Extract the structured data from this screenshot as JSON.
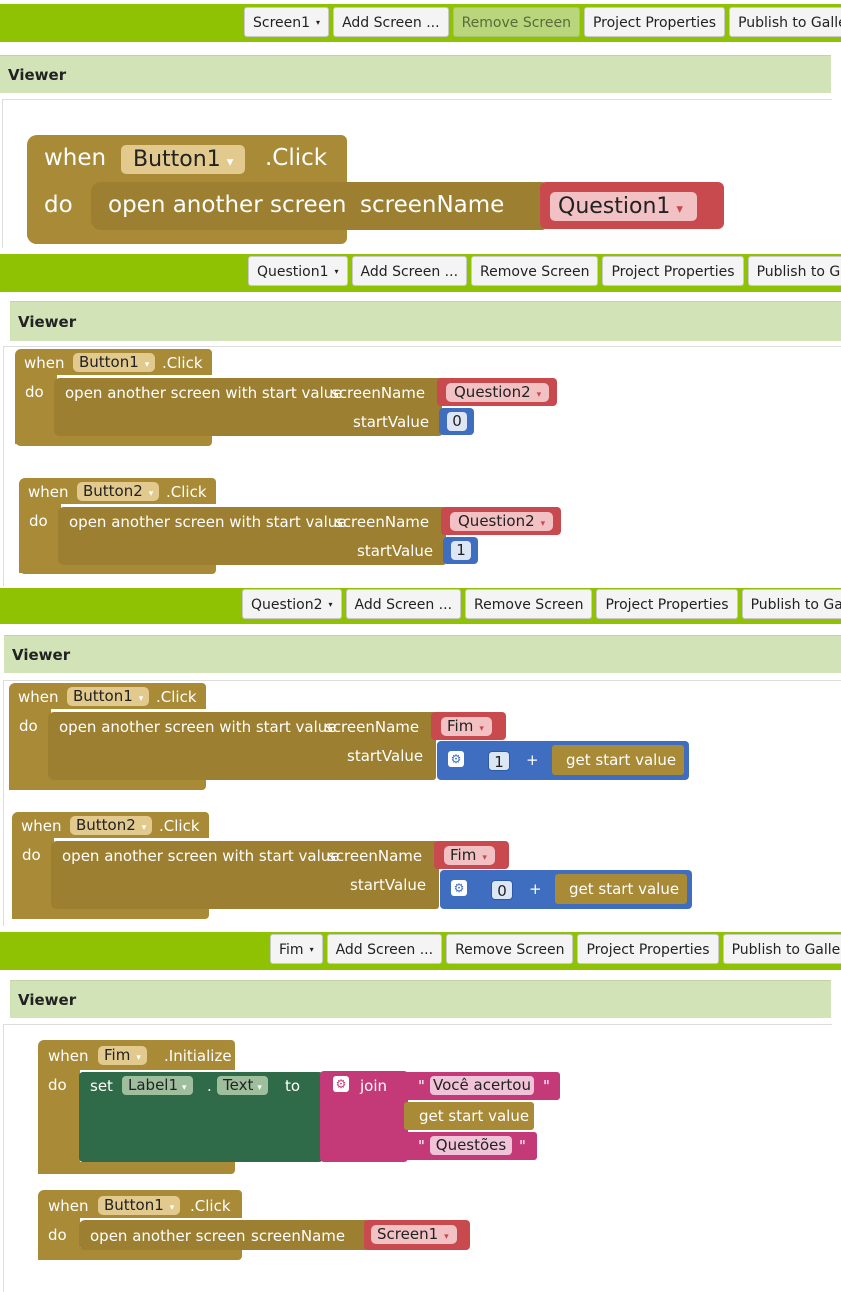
{
  "toolbar": {
    "add_screen": "Add Screen ...",
    "remove_screen": "Remove Screen",
    "project_properties": "Project Properties",
    "publish": "Publish to Gallery"
  },
  "viewer_label": "Viewer",
  "panels": [
    {
      "screen": "Screen1",
      "remove_disabled": true,
      "blocks": [
        {
          "when": "when",
          "component": "Button1",
          "event": ".Click",
          "do": "do",
          "action": "open another screen",
          "param": "screenName",
          "value": "Question1"
        }
      ]
    },
    {
      "screen": "Question1",
      "blocks": [
        {
          "when": "when",
          "component": "Button1",
          "event": ".Click",
          "do": "do",
          "action": "open another screen with start value",
          "param": "screenName",
          "value": "Question2",
          "param2": "startValue",
          "start": "0"
        },
        {
          "when": "when",
          "component": "Button2",
          "event": ".Click",
          "do": "do",
          "action": "open another screen with start value",
          "param": "screenName",
          "value": "Question2",
          "param2": "startValue",
          "start": "1"
        }
      ]
    },
    {
      "screen": "Question2",
      "blocks": [
        {
          "when": "when",
          "component": "Button1",
          "event": ".Click",
          "do": "do",
          "action": "open another screen with start value",
          "param": "screenName",
          "value": "Fim",
          "param2": "startValue",
          "start": "1",
          "op": "+",
          "getter": "get start value"
        },
        {
          "when": "when",
          "component": "Button2",
          "event": ".Click",
          "do": "do",
          "action": "open another screen with start value",
          "param": "screenName",
          "value": "Fim",
          "param2": "startValue",
          "start": "0",
          "op": "+",
          "getter": "get start value"
        }
      ]
    },
    {
      "screen": "Fim",
      "blocks": [
        {
          "when": "when",
          "component": "Fim",
          "event": ".Initialize",
          "do": "do",
          "set": "set",
          "target": "Label1",
          "dot": ".",
          "prop": "Text",
          "to": "to",
          "join": "join",
          "str1": "Você acertou",
          "getter": "get start value",
          "str2": "Questões",
          "quote": "\""
        },
        {
          "when": "when",
          "component": "Button1",
          "event": ".Click",
          "do": "do",
          "action": "open another screen",
          "param": "screenName",
          "value": "Screen1"
        }
      ]
    }
  ],
  "icons": {
    "caret": "▾",
    "gear": "⚙"
  },
  "colors": {
    "green_bar": "#8fc202",
    "viewer": "#d3e3b8",
    "event": "#a88a37",
    "text_block": "#c94a4e",
    "math": "#3f6ec0",
    "set": "#2f6b49",
    "join": "#c43a78"
  }
}
